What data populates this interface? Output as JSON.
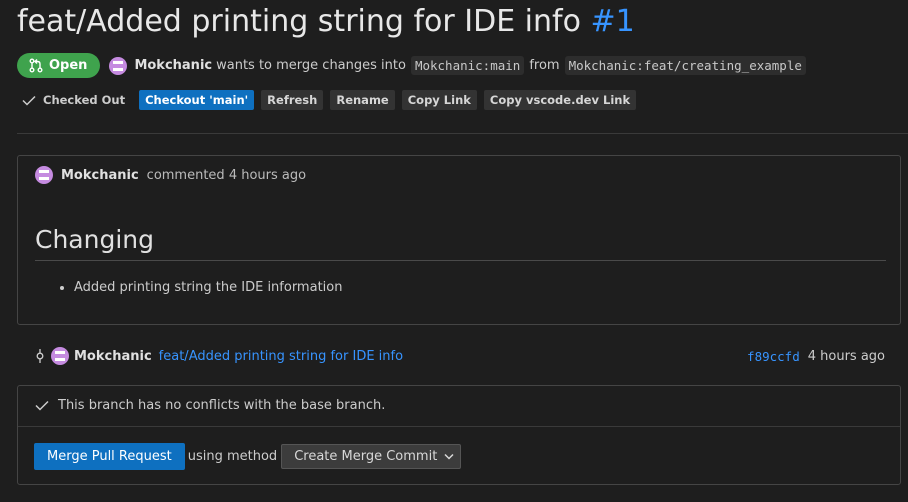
{
  "pr": {
    "title": "feat/Added printing string for IDE info",
    "number": "#1",
    "status": "Open",
    "author": "Mokchanic",
    "merge_text": "wants to merge changes into",
    "target_branch": "Mokchanic:main",
    "from_text": "from",
    "source_branch": "Mokchanic:feat/creating_example"
  },
  "actions": {
    "checked_out_label": "Checked Out",
    "checkout_label": "Checkout 'main'",
    "refresh_label": "Refresh",
    "rename_label": "Rename",
    "copy_link_label": "Copy Link",
    "copy_vscode_label": "Copy vscode.dev Link"
  },
  "comment": {
    "author": "Mokchanic",
    "meta": "commented 4 hours ago",
    "heading": "Changing",
    "items": [
      "Added printing string the IDE information"
    ]
  },
  "commit": {
    "author": "Mokchanic",
    "message": "feat/Added printing string for IDE info",
    "sha": "f89ccfd",
    "time": "4 hours ago"
  },
  "merge": {
    "status_text": "This branch has no conflicts with the base branch.",
    "button_label": "Merge Pull Request",
    "method_label": "using method",
    "method_value": "Create Merge Commit"
  },
  "colors": {
    "accent": "#0e70c0",
    "link": "#3794ff",
    "open_badge": "#3fa34d",
    "background": "#1e1e1e"
  }
}
